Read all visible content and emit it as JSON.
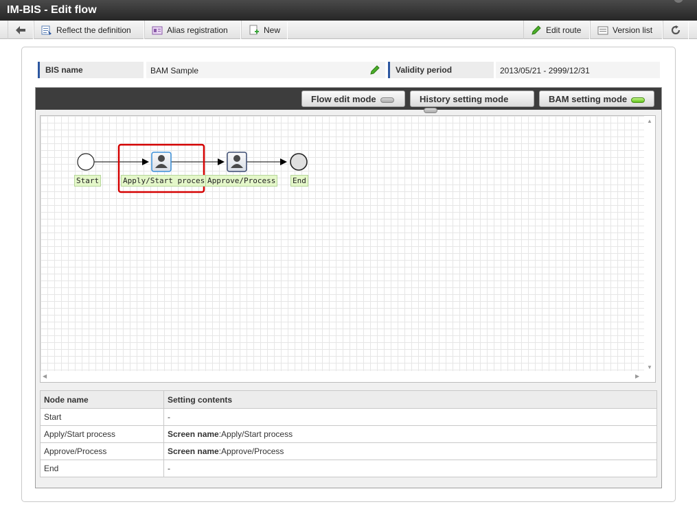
{
  "window": {
    "title": "IM-BIS - Edit flow"
  },
  "toolbar": {
    "left": [
      {
        "label": "Reflect the definition"
      },
      {
        "label": "Alias registration"
      },
      {
        "label": "New"
      }
    ],
    "right": [
      {
        "label": "Edit route"
      },
      {
        "label": "Version list"
      }
    ]
  },
  "info": {
    "bis_name_label": "BIS name",
    "bis_name_value": "BAM Sample",
    "validity_label": "Validity period",
    "validity_value": "2013/05/21 - 2999/12/31"
  },
  "modes": [
    {
      "label": "Flow edit mode",
      "active": false
    },
    {
      "label": "History setting mode",
      "active": false
    },
    {
      "label": "BAM setting mode",
      "active": true
    }
  ],
  "flow": {
    "nodes": [
      {
        "label": "Start",
        "kind": "start-event"
      },
      {
        "label": "Apply/Start process",
        "kind": "user-task",
        "selected": true
      },
      {
        "label": "Approve/Process",
        "kind": "user-task",
        "selected": false
      },
      {
        "label": "End",
        "kind": "end-event"
      }
    ],
    "selection_color": "#d40000"
  },
  "table": {
    "headers": [
      "Node name",
      "Setting contents"
    ],
    "rows": [
      {
        "node": "Start",
        "setting_key": "",
        "setting_value": "-"
      },
      {
        "node": "Apply/Start process",
        "setting_key": "Screen name",
        "setting_value": ":Apply/Start process"
      },
      {
        "node": "Approve/Process",
        "setting_key": "Screen name",
        "setting_value": ":Approve/Process"
      },
      {
        "node": "End",
        "setting_key": "",
        "setting_value": "-"
      }
    ]
  }
}
